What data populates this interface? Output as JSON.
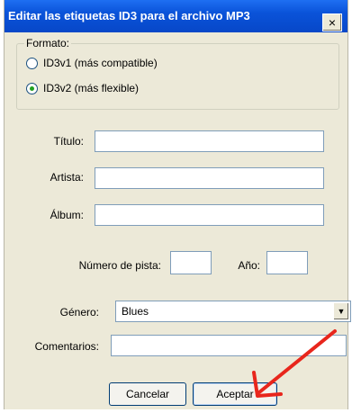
{
  "window": {
    "title": "Editar las etiquetas ID3 para el archivo MP3",
    "close_label": "×"
  },
  "format": {
    "legend": "Formato:",
    "options": [
      {
        "label": "ID3v1 (más compatible)",
        "selected": false
      },
      {
        "label": "ID3v2 (más flexible)",
        "selected": true
      }
    ]
  },
  "fields": {
    "title_label": "Título:",
    "title_value": "",
    "artist_label": "Artista:",
    "artist_value": "",
    "album_label": "Álbum:",
    "album_value": "",
    "track_label": "Número de pista:",
    "track_value": "",
    "year_label": "Año:",
    "year_value": "",
    "genre_label": "Género:",
    "genre_value": "Blues",
    "comments_label": "Comentarios:",
    "comments_value": ""
  },
  "buttons": {
    "cancel": "Cancelar",
    "accept": "Aceptar"
  },
  "annotation": {
    "arrow_color": "#e8261c"
  }
}
